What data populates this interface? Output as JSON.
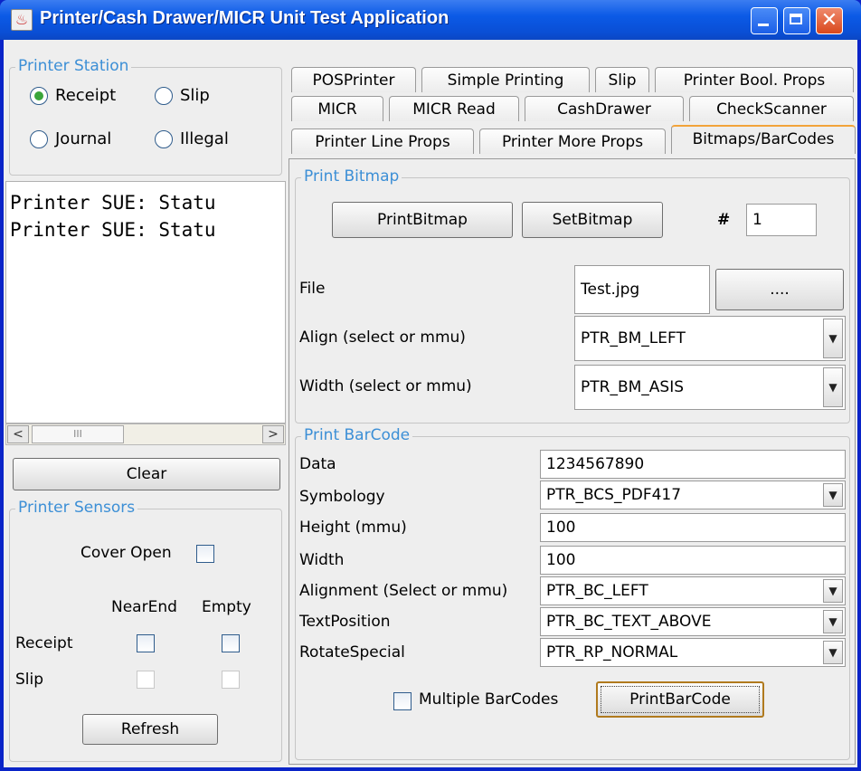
{
  "window": {
    "title": "Printer/Cash Drawer/MICR Unit Test Application"
  },
  "printer_station": {
    "title": "Printer Station",
    "options": [
      "Receipt",
      "Slip",
      "Journal",
      "Illegal"
    ],
    "selected": "Receipt"
  },
  "log": {
    "lines": [
      "Printer SUE: Statu",
      "Printer SUE: Statu"
    ]
  },
  "scrollbar": {
    "thumb_grip": "III",
    "left_arrow": "<",
    "right_arrow": ">"
  },
  "clear_label": "Clear",
  "sensors": {
    "title": "Printer Sensors",
    "cover_open_label": "Cover Open",
    "near_end_label": "NearEnd",
    "empty_label": "Empty",
    "receipt_label": "Receipt",
    "slip_label": "Slip",
    "refresh_label": "Refresh"
  },
  "tabs": {
    "row1": [
      "POSPrinter",
      "Simple Printing",
      "Slip",
      "Printer Bool. Props"
    ],
    "row2": [
      "MICR",
      "MICR Read",
      "CashDrawer",
      "CheckScanner"
    ],
    "row3": [
      "Printer Line Props",
      "Printer More Props",
      "Bitmaps/BarCodes"
    ],
    "active": "Bitmaps/BarCodes"
  },
  "print_bitmap": {
    "title": "Print Bitmap",
    "print_bitmap_label": "PrintBitmap",
    "set_bitmap_label": "SetBitmap",
    "number_label": "#",
    "number_value": "1",
    "file_label": "File",
    "file_value": "Test.jpg",
    "browse_label": "....",
    "align_label": "Align (select or mmu)",
    "align_value": "PTR_BM_LEFT",
    "width_label": "Width (select or mmu)",
    "width_value": "PTR_BM_ASIS"
  },
  "print_barcode": {
    "title": "Print BarCode",
    "data_label": "Data",
    "data_value": "1234567890",
    "symbology_label": "Symbology",
    "symbology_value": "PTR_BCS_PDF417",
    "height_label": "Height (mmu)",
    "height_value": "100",
    "width_label": "Width",
    "width_value": "100",
    "alignment_label": "Alignment (Select or mmu)",
    "alignment_value": "PTR_BC_LEFT",
    "textposition_label": "TextPosition",
    "textposition_value": "PTR_BC_TEXT_ABOVE",
    "rotate_label": "RotateSpecial",
    "rotate_value": "PTR_RP_NORMAL",
    "multiple_label": "Multiple BarCodes",
    "print_barcode_label": "PrintBarCode"
  }
}
